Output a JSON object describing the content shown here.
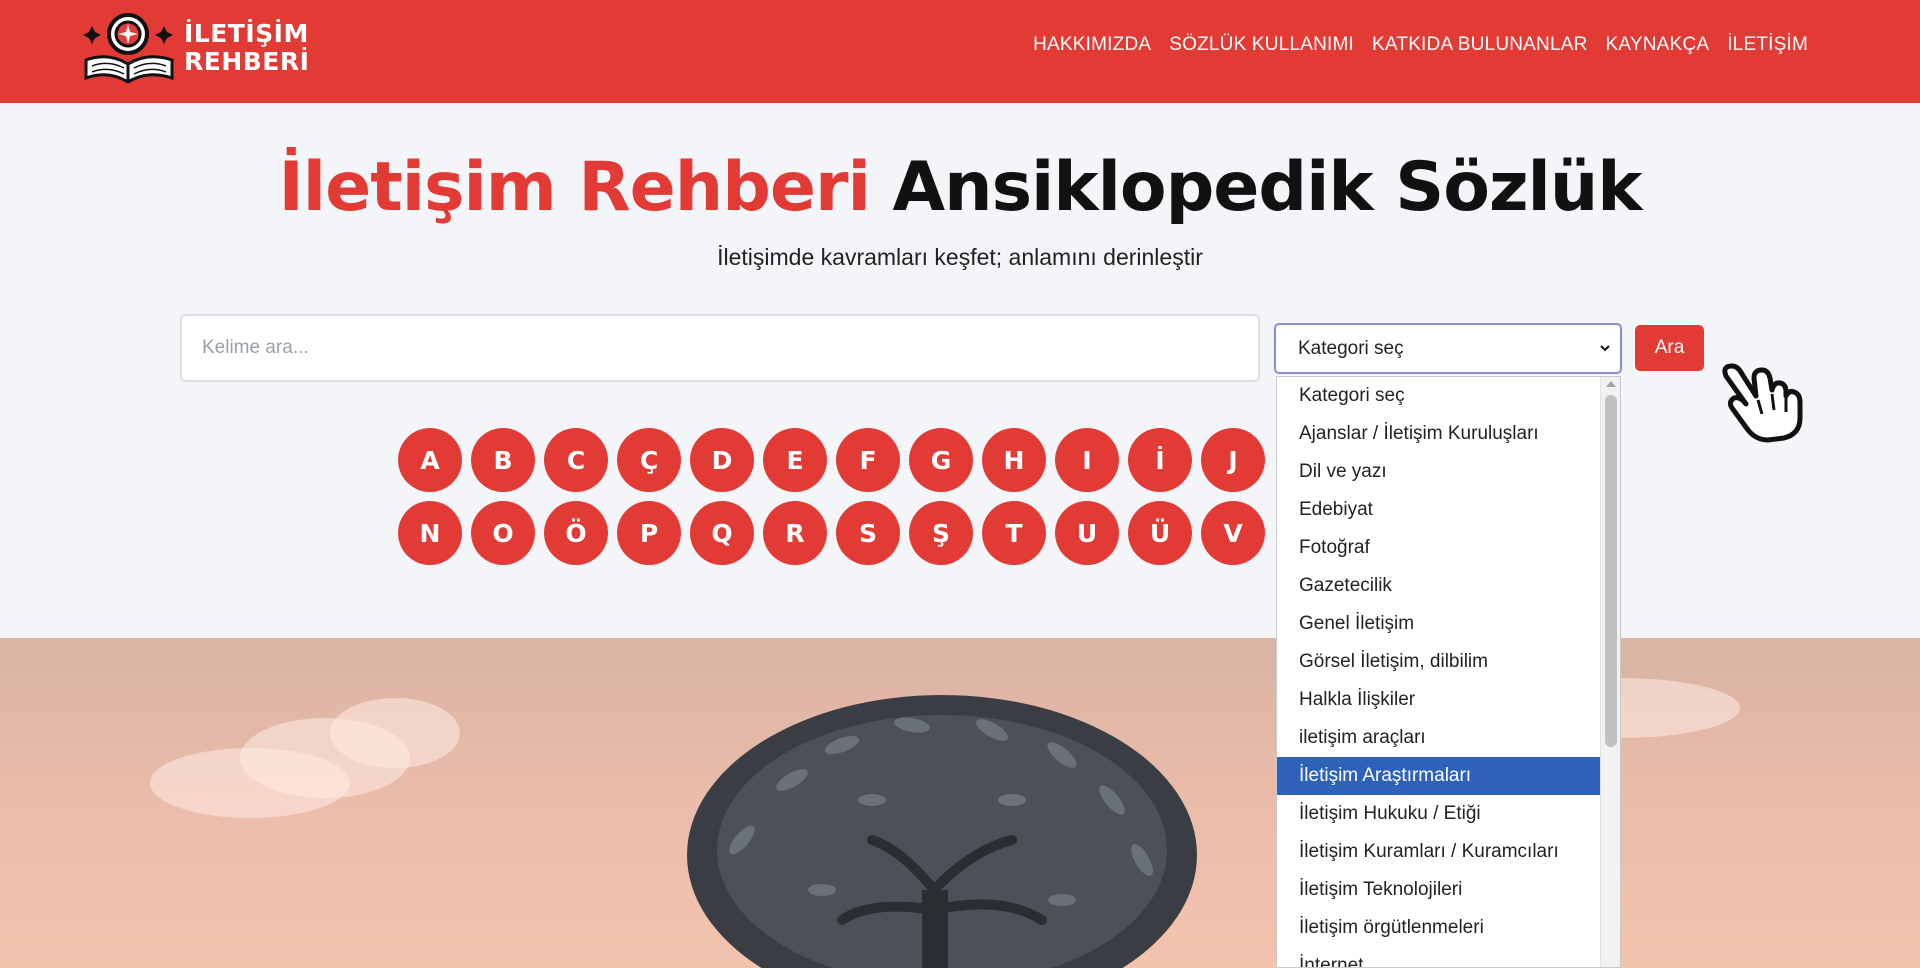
{
  "header": {
    "logo_line1": "İLETİŞİM",
    "logo_line2": "REHBERİ",
    "nav": [
      "HAKKIMIZDA",
      "SÖZLÜK KULLANIMI",
      "KATKIDA BULUNANLAR",
      "KAYNAKÇA",
      "İLETİŞİM"
    ]
  },
  "hero": {
    "title_red": "İletişim Rehberi",
    "title_black": "Ansiklopedik Sözlük",
    "subtitle": "İletişimde kavramları keşfet; anlamını derinleştir"
  },
  "search": {
    "placeholder": "Kelime ara...",
    "category_selected": "Kategori seç",
    "button_label": "Ara"
  },
  "letters": {
    "row1": [
      "A",
      "B",
      "C",
      "Ç",
      "D",
      "E",
      "F",
      "G",
      "H",
      "I",
      "İ",
      "J"
    ],
    "row2": [
      "N",
      "O",
      "Ö",
      "P",
      "Q",
      "R",
      "S",
      "Ş",
      "T",
      "U",
      "Ü",
      "V"
    ]
  },
  "dropdown": {
    "items": [
      "Kategori seç",
      "Ajanslar / İletişim Kuruluşları",
      "Dil ve yazı",
      "Edebiyat",
      "Fotoğraf",
      "Gazetecilik",
      "Genel İletişim",
      "Görsel İletişim, dilbilim",
      "Halkla İlişkiler",
      "iletişim araçları",
      "İletişim Araştırmaları",
      "İletişim Hukuku / Etiği",
      "İletişim Kuramları / Kuramcıları",
      "İletişim Teknolojileri",
      "İletişim örgütlenmeleri",
      "İnternet"
    ],
    "highlighted_index": 10
  },
  "colors": {
    "brand_red": "#e23b36",
    "dropdown_highlight": "#2d62b8"
  },
  "icons": {
    "logo": "book-magnifier-icon",
    "select_caret": "chevron-down-icon",
    "cursor": "pointing-hand-icon"
  }
}
